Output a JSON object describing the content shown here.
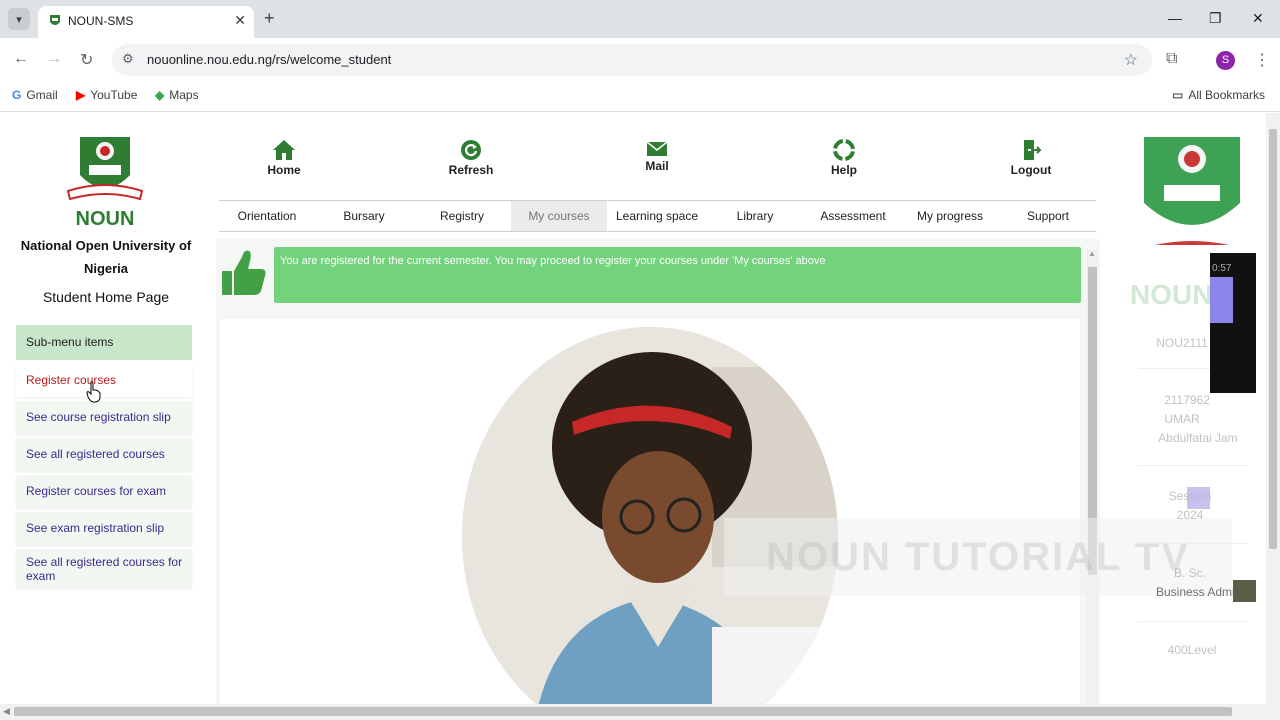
{
  "browser": {
    "tab_title": "NOUN-SMS",
    "url": "nouonline.nou.edu.ng/rs/welcome_student",
    "profile_initial": "S",
    "bookmarks": [
      {
        "label": "Gmail",
        "icon": "google-icon"
      },
      {
        "label": "YouTube",
        "icon": "youtube-icon"
      },
      {
        "label": "Maps",
        "icon": "maps-icon"
      }
    ],
    "all_bookmarks_label": "All Bookmarks"
  },
  "sidebar": {
    "logo_text": "NOUN",
    "university_name": "National Open University of Nigeria",
    "page_title": "Student Home Page",
    "submenu_header": "Sub-menu items",
    "items": [
      {
        "label": "Register courses",
        "active": true
      },
      {
        "label": "See course registration slip"
      },
      {
        "label": "See all registered courses"
      },
      {
        "label": "Register courses for exam"
      },
      {
        "label": "See exam registration slip"
      },
      {
        "label": "See all registered courses for exam"
      }
    ]
  },
  "top_nav": {
    "home": "Home",
    "refresh": "Refresh",
    "mail": "Mail",
    "help": "Help",
    "logout": "Logout"
  },
  "menu": [
    "Orientation",
    "Bursary",
    "Registry",
    "My courses",
    "Learning space",
    "Library",
    "Assessment",
    "My progress",
    "Support"
  ],
  "menu_current": "My courses",
  "notice": {
    "message": "You are registered for the current semester. You may proceed to register your courses under 'My courses' above"
  },
  "watermark": "NOUN TUTORIAL TV",
  "right_panel": {
    "logo_text": "NOUN",
    "matric": "NOU2111",
    "id": "2117962",
    "name_1": "UMAR",
    "name_2": "Abdulfatai Jam",
    "session_label": "Session",
    "session": "2024",
    "degree": "B. Sc.",
    "programme": "Business Admini",
    "level": "400Level",
    "overlay_time": "0:57"
  },
  "colors": {
    "brand_green": "#2e7d32",
    "notice_green": "#73d27c",
    "submenu_header": "#c8e6c9",
    "link_purple": "#3b2a8f",
    "active_red": "#b71c1c"
  }
}
